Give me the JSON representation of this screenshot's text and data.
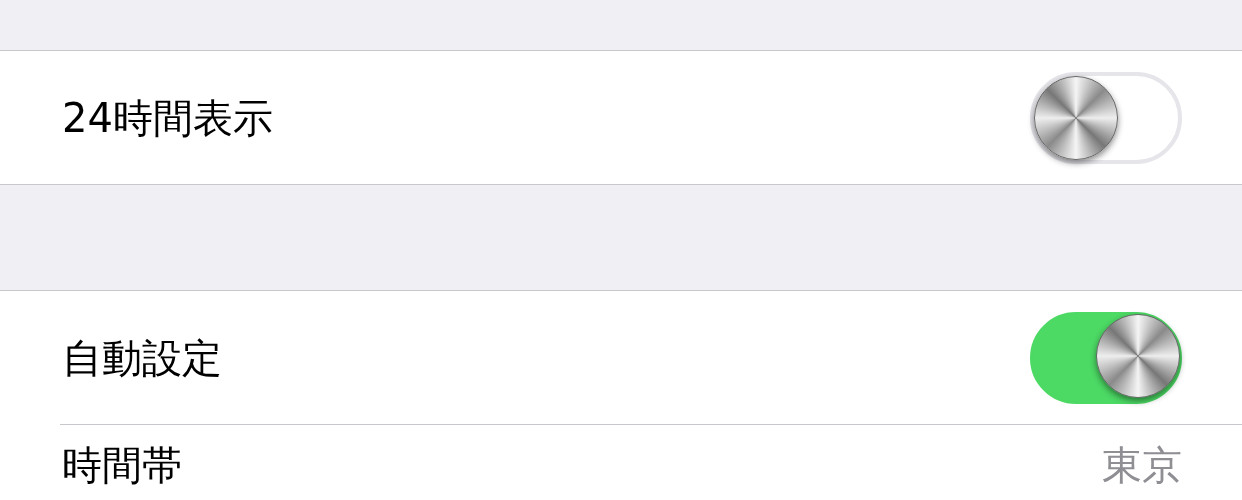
{
  "groups": [
    {
      "rows": [
        {
          "kind": "toggle",
          "label": "24時間表示",
          "on": false
        }
      ]
    },
    {
      "rows": [
        {
          "kind": "toggle",
          "label": "自動設定",
          "on": true
        },
        {
          "kind": "value",
          "label": "時間帯",
          "value": "東京"
        }
      ]
    }
  ]
}
